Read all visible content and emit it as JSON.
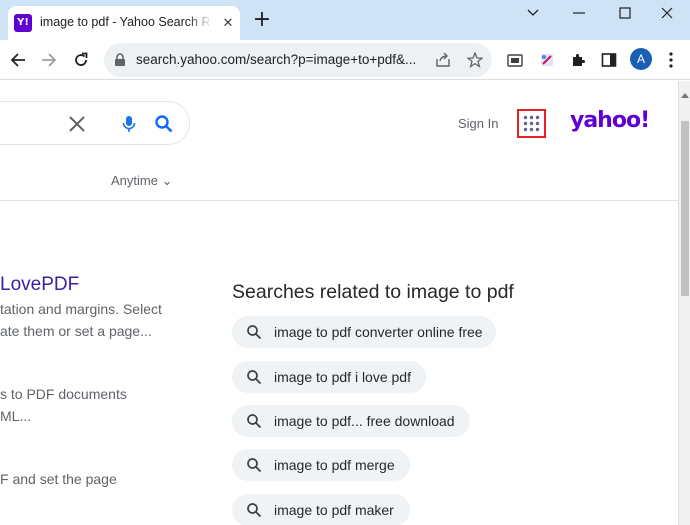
{
  "browser": {
    "tab": {
      "title": "image to pdf - Yahoo Search Results",
      "favicon": "Y!",
      "close": "✕"
    },
    "new_tab": "+",
    "address_bar": {
      "url": "search.yahoo.com/search?p=image+to+pdf&..."
    },
    "profile_initial": "A"
  },
  "header": {
    "sign_in": "Sign In",
    "logo": "yahoo!"
  },
  "filters": {
    "time": "Anytime ⌄"
  },
  "results": {
    "title": "LovePDF",
    "snippets": [
      "tation and margins. Select",
      "ate them or set a page...",
      "s to PDF documents",
      "ML...",
      "F and set the page"
    ]
  },
  "related": {
    "heading": "Searches related to image to pdf",
    "items": [
      "image to pdf converter online free",
      "image to pdf i love pdf",
      "image to pdf... free download",
      "image to pdf merge",
      "image to pdf maker"
    ]
  },
  "colors": {
    "brand": "#6001d2",
    "highlight": "#e21e26",
    "link": "#3b1f9c"
  }
}
